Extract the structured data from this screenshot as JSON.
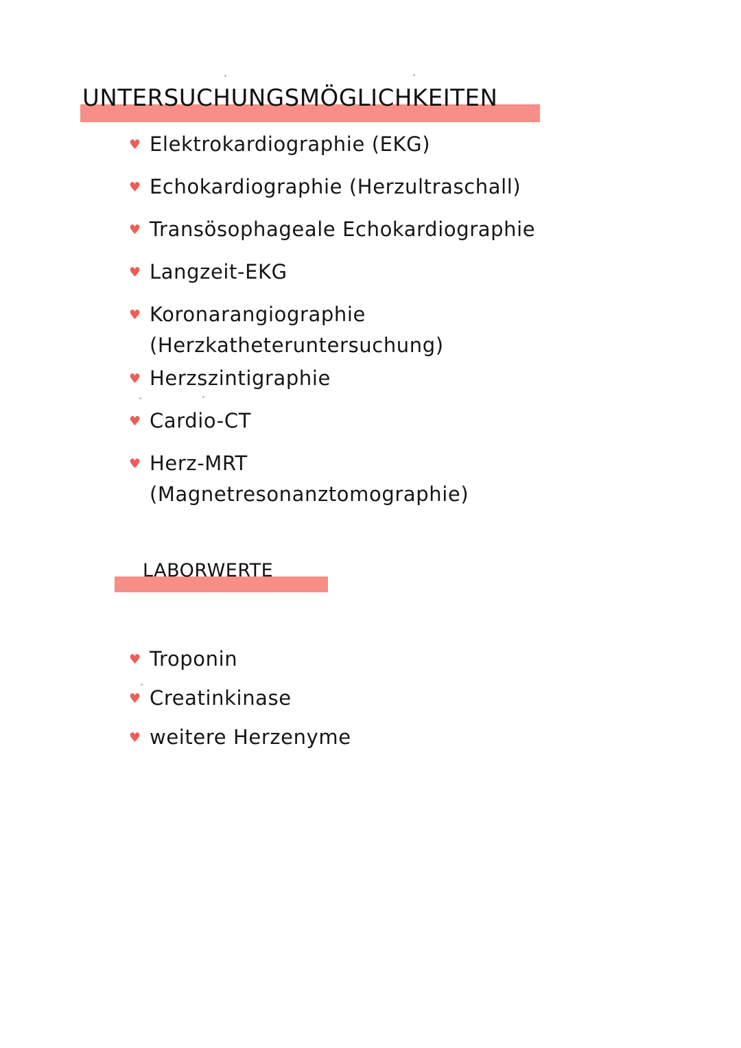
{
  "document": {
    "background_color": "#ffffff",
    "text_color": "#161616",
    "highlight_color": "#F78E88",
    "bullet_color": "#F05C56",
    "bullet_glyph": "♥"
  },
  "sections": [
    {
      "id": "untersuchungen",
      "heading": "Untersuchungsmöglichkeiten",
      "items": [
        {
          "text": "Elektrokardiographie (EKG)",
          "sub": null
        },
        {
          "text": "Echokardiographie (Herzultraschall)",
          "sub": null
        },
        {
          "text": "Transösophageale Echokardiographie",
          "sub": null
        },
        {
          "text": "Langzeit-EKG",
          "sub": null
        },
        {
          "text": "Koronarangiographie",
          "sub": "(Herzkatheteruntersuchung)"
        },
        {
          "text": "Herzszintigraphie",
          "sub": null
        },
        {
          "text": "Cardio-CT",
          "sub": null
        },
        {
          "text": "Herz-MRT",
          "sub": "(Magnetresonanztomographie)"
        }
      ]
    },
    {
      "id": "laborwerte",
      "heading": "Laborwerte",
      "items": [
        {
          "text": "Troponin",
          "sub": null
        },
        {
          "text": "Creatinkinase",
          "sub": null
        },
        {
          "text": "weitere Herzenyme",
          "sub": null
        }
      ]
    }
  ]
}
